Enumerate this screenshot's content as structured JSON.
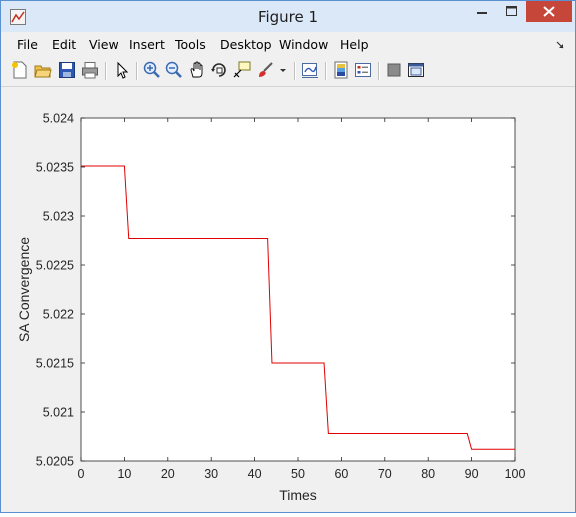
{
  "window": {
    "title": "Figure 1"
  },
  "menu": [
    "File",
    "Edit",
    "View",
    "Insert",
    "Tools",
    "Desktop",
    "Window",
    "Help"
  ],
  "toolbar_icons": [
    "new-figure-icon",
    "open-file-icon",
    "save-icon",
    "print-icon",
    "select-pointer-icon",
    "zoom-in-icon",
    "zoom-out-icon",
    "pan-hand-icon",
    "rotate-3d-icon",
    "data-cursor-icon",
    "brush-icon",
    "brush-dropdown-icon",
    "link-plot-icon",
    "insert-colorbar-icon",
    "insert-legend-icon",
    "hide-plot-tools-icon",
    "show-plot-tools-icon"
  ],
  "chart_data": {
    "type": "line",
    "xlabel": "Times",
    "ylabel": "SA Convergence",
    "xlim": [
      0,
      100
    ],
    "ylim": [
      5.0205,
      5.024
    ],
    "xticks": [
      "0",
      "10",
      "20",
      "30",
      "40",
      "50",
      "60",
      "70",
      "80",
      "90",
      "100"
    ],
    "yticks": [
      "5.0205",
      "5.021",
      "5.0215",
      "5.022",
      "5.0225",
      "5.023",
      "5.0235",
      "5.024"
    ],
    "grid": false,
    "series": [
      {
        "color": "#e00000",
        "x": [
          0,
          10,
          11,
          43,
          44,
          56,
          57,
          89,
          90,
          100
        ],
        "y": [
          5.02351,
          5.02351,
          5.02277,
          5.02277,
          5.0215,
          5.0215,
          5.02078,
          5.02078,
          5.02062,
          5.02062
        ]
      }
    ]
  }
}
